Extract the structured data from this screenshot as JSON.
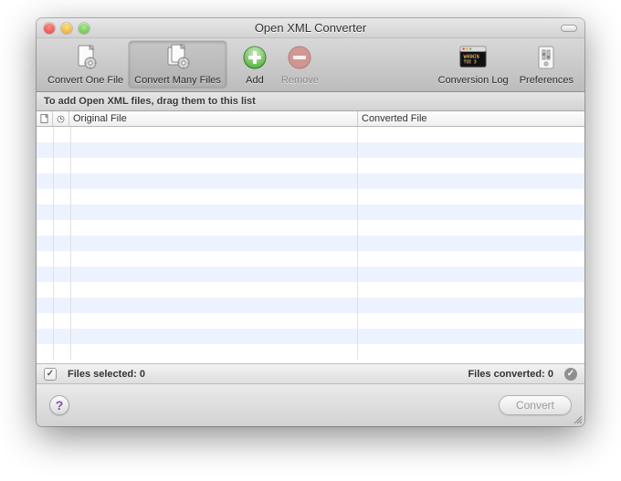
{
  "window": {
    "title": "Open XML Converter"
  },
  "toolbar": {
    "convert_one": "Convert One File",
    "convert_many": "Convert Many Files",
    "add": "Add",
    "remove": "Remove",
    "conversion_log": "Conversion Log",
    "preferences": "Preferences"
  },
  "instruction": "To add Open XML files, drag them to this list",
  "table": {
    "col_original": "Original File",
    "col_converted": "Converted File",
    "row_count": 15
  },
  "status": {
    "selected_label": "Files selected: 0",
    "converted_label": "Files converted: 0",
    "check_mark": "✓",
    "badge_mark": "✓"
  },
  "bottom": {
    "help_glyph": "?",
    "convert_label": "Convert"
  }
}
